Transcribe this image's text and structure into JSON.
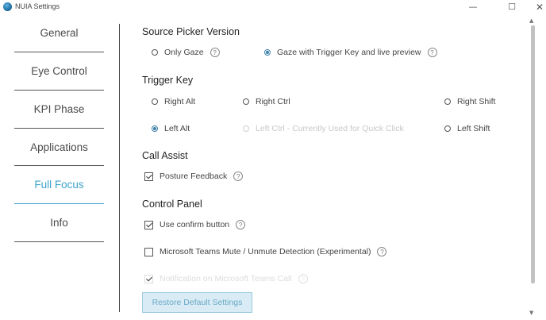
{
  "window": {
    "title": "NUIA Settings",
    "minimize_glyph": "—",
    "maximize_glyph": "☐",
    "close_glyph": "✕"
  },
  "sidebar": {
    "items": [
      {
        "label": "General",
        "active": false
      },
      {
        "label": "Eye Control",
        "active": false
      },
      {
        "label": "KPI Phase",
        "active": false
      },
      {
        "label": "Applications",
        "active": false
      },
      {
        "label": "Full Focus",
        "active": true
      },
      {
        "label": "Info",
        "active": false
      }
    ]
  },
  "source_picker": {
    "title": "Source Picker Version",
    "options": [
      {
        "label": "Only Gaze",
        "checked": false
      },
      {
        "label": "Gaze with Trigger Key and live preview",
        "checked": true
      }
    ]
  },
  "trigger_key": {
    "title": "Trigger Key",
    "options": [
      {
        "label": "Right Alt",
        "checked": false,
        "disabled": false
      },
      {
        "label": "Right Ctrl",
        "checked": false,
        "disabled": false
      },
      {
        "label": "Right Shift",
        "checked": false,
        "disabled": false
      },
      {
        "label": "Left Alt",
        "checked": true,
        "disabled": false
      },
      {
        "label": "Left Ctrl - Currently Used for Quick Click",
        "checked": false,
        "disabled": true
      },
      {
        "label": "Left Shift",
        "checked": false,
        "disabled": false
      }
    ]
  },
  "call_assist": {
    "title": "Call Assist",
    "posture_feedback": {
      "label": "Posture Feedback",
      "checked": true
    }
  },
  "control_panel": {
    "title": "Control Panel",
    "use_confirm": {
      "label": "Use confirm button",
      "checked": true
    },
    "teams_mute": {
      "label": "Microsoft Teams Mute / Unmute Detection (Experimental)",
      "checked": false
    },
    "teams_call": {
      "label": "Notification on Microsoft Teams Call",
      "checked": true
    }
  },
  "help_glyph": "?",
  "restore_button": {
    "label": "Restore Default Settings"
  },
  "scroll_glyphs": {
    "up": "▲",
    "down": "▼"
  }
}
